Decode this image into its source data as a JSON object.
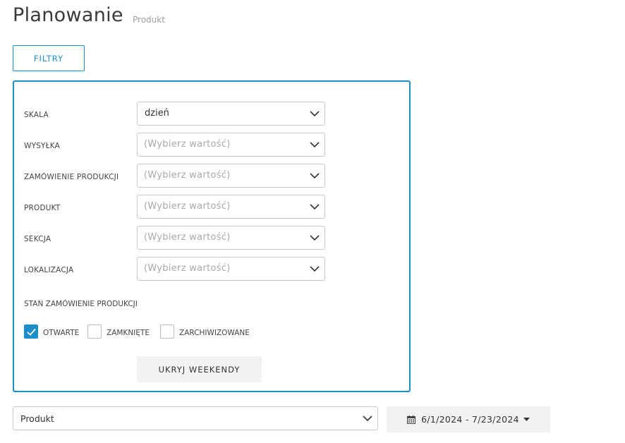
{
  "header": {
    "title": "Planowanie",
    "subtitle": "Produkt"
  },
  "filters_button": {
    "label": "FILTRY"
  },
  "filters": {
    "rows": [
      {
        "label": "SKALA",
        "value": "dzień",
        "placeholder": ""
      },
      {
        "label": "WYSYŁKA",
        "value": "",
        "placeholder": "(Wybierz wartość)"
      },
      {
        "label": "ZAMÓWIENIE PRODUKCJI",
        "value": "",
        "placeholder": "(Wybierz wartość)"
      },
      {
        "label": "PRODUKT",
        "value": "",
        "placeholder": "(Wybierz wartość)"
      },
      {
        "label": "SEKCJA",
        "value": "",
        "placeholder": "(Wybierz wartość)"
      },
      {
        "label": "LOKALIZACJA",
        "value": "",
        "placeholder": "(Wybierz wartość)"
      }
    ],
    "state_label": "STAN ZAMÓWIENIE PRODUKCJI",
    "states": [
      {
        "label": "OTWARTE",
        "checked": true
      },
      {
        "label": "ZAMKNIĘTE",
        "checked": false
      },
      {
        "label": "ZARCHIWIZOWANE",
        "checked": false
      }
    ],
    "hide_weekends_label": "UKRYJ WEEKENDY"
  },
  "view_select": {
    "value": "Produkt"
  },
  "date_range": {
    "label": "6/1/2024 - 7/23/2024",
    "icon": "calendar-icon"
  },
  "colors": {
    "accent": "#1c8ec9"
  }
}
